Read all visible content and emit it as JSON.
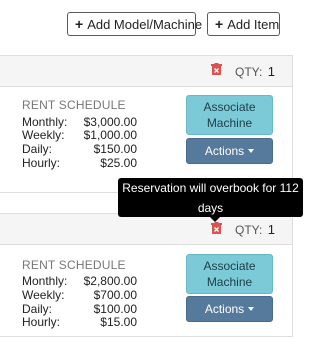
{
  "toolbar": {
    "add_model_label": "Add Model/Machine",
    "add_item_label": "Add Item",
    "plus": "+"
  },
  "qty_label": "QTY:",
  "items": [
    {
      "qty": "1",
      "rent_title": "RENT SCHEDULE",
      "rates": [
        {
          "label": "Monthly:",
          "value": "$3,000.00"
        },
        {
          "label": "Weekly:",
          "value": "$1,000.00"
        },
        {
          "label": "Daily:",
          "value": "$150.00"
        },
        {
          "label": "Hourly:",
          "value": "$25.00"
        }
      ],
      "associate_label": "Associate Machine",
      "actions_label": "Actions"
    },
    {
      "qty": "1",
      "rent_title": "RENT SCHEDULE",
      "rates": [
        {
          "label": "Monthly:",
          "value": "$2,800.00"
        },
        {
          "label": "Weekly:",
          "value": "$700.00"
        },
        {
          "label": "Daily:",
          "value": "$100.00"
        },
        {
          "label": "Hourly:",
          "value": "$15.00"
        }
      ],
      "associate_label": "Associate Machine",
      "actions_label": "Actions"
    }
  ],
  "tooltip": {
    "text": "Reservation will overbook for 112 days"
  },
  "colors": {
    "trash_icon": "#d9534f",
    "associate_button": "#7ccad7",
    "actions_button": "#557a9c"
  }
}
